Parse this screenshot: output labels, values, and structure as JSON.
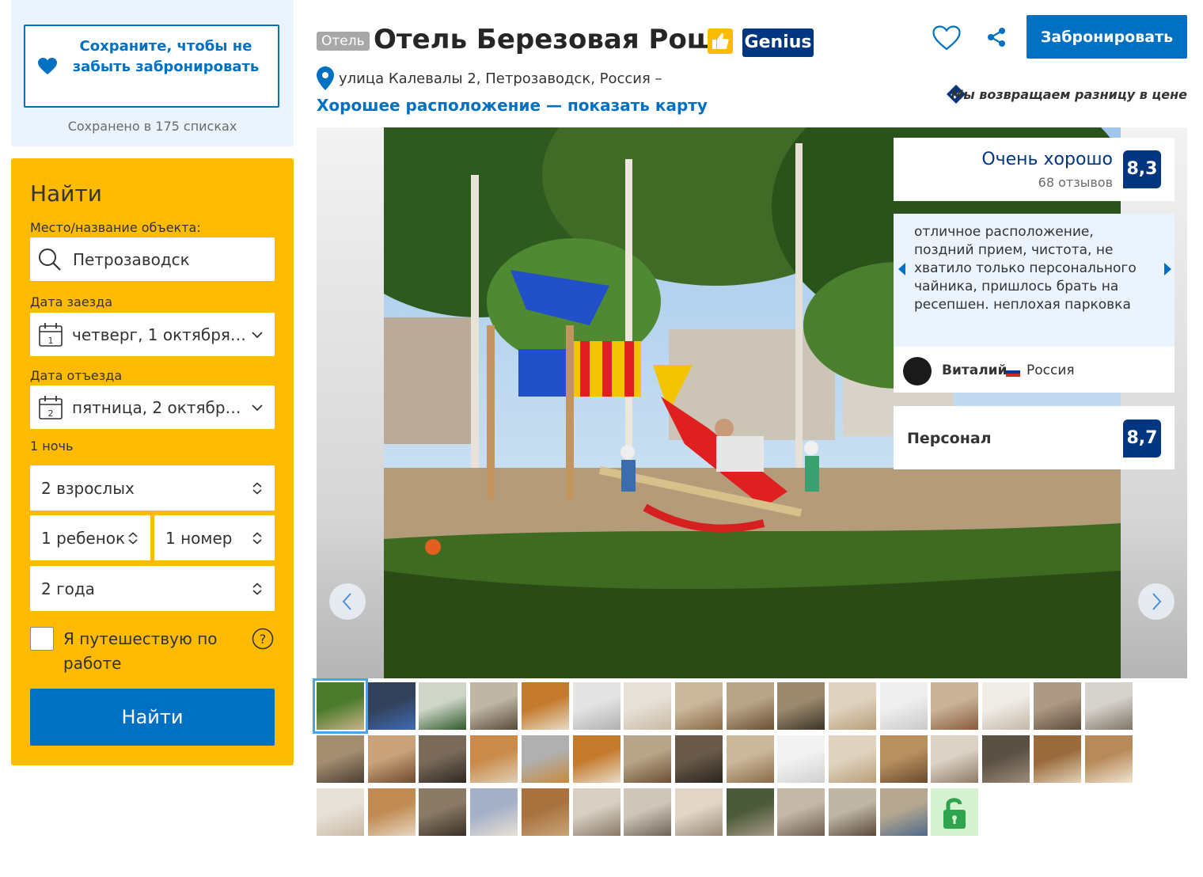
{
  "sidebar": {
    "save_label": "Сохраните, чтобы не забыть забронировать",
    "saved_count": "Сохранено в 175 списках",
    "search": {
      "title": "Найти",
      "destination_label": "Место/название объекта:",
      "destination_value": "Петрозаводск",
      "checkin_label": "Дата заезда",
      "checkin_value": "четверг, 1 октября 2...",
      "checkin_day": "1",
      "checkout_label": "Дата отъезда",
      "checkout_value": "пятница, 2 октября 2...",
      "checkout_day": "2",
      "nights": "1 ночь",
      "adults": "2 взрослых",
      "children": "1 ребенок",
      "rooms": "1 номер",
      "child_age": "2 года",
      "business_travel": "Я путешествую по работе",
      "help_glyph": "?",
      "submit": "Найти"
    }
  },
  "header": {
    "type_badge": "Отель",
    "hotel_name": "Отель Березовая Роща",
    "genius": "Genius",
    "address": "улица Калевалы 2, Петрозаводск, Россия –",
    "map_link": "Хорошее расположение — показать карту",
    "book_button": "Забронировать",
    "price_guarantee": "Мы возвращаем разницу в цене"
  },
  "rating": {
    "word": "Очень хорошо",
    "reviews": "68 отзывов",
    "score": "8,3"
  },
  "review": {
    "text": "отличное расположение, поздний прием, чистота, не хватило только персонального чайника, пришлось брать на ресепшен. неплохая парковка",
    "author": "Виталий",
    "country": "Россия"
  },
  "staff": {
    "label": "Персонал",
    "score": "8,7"
  },
  "thumbnails": {
    "rows": [
      [
        "playground",
        "blue-sofa",
        "bathroom-green",
        "room-desk",
        "room-bed-orange",
        "shower",
        "bathroom-sink",
        "room-twin",
        "room-bed",
        "room-tv",
        "room-bed-light",
        "bathroom-white",
        "corridor",
        "toilet",
        "room-interior",
        "room-window"
      ],
      [
        "room-chair",
        "room-door",
        "room-tv-dark",
        "room-orange",
        "building",
        "room-bed-orange",
        "room-bed",
        "room-dark",
        "room-twin",
        "toilet-white",
        "room-bed-light",
        "corridor-door",
        "shower-curtain",
        "room-window-dark",
        "room-bed-wood",
        "room-bed-double"
      ],
      [
        "bathroom-sink",
        "wardrobe",
        "room-table",
        "room-bed-blue",
        "wardrobe-wood",
        "room-door-open",
        "room-kitchen",
        "curtain-room",
        "room-mirror",
        "room-hall",
        "room-desk",
        "room-sofa",
        "locked"
      ]
    ],
    "selected_index": 0
  },
  "colors": {
    "primary": "#0071c2",
    "dark_blue": "#003580",
    "yellow": "#febb02",
    "light_blue": "#ebf3ff"
  }
}
